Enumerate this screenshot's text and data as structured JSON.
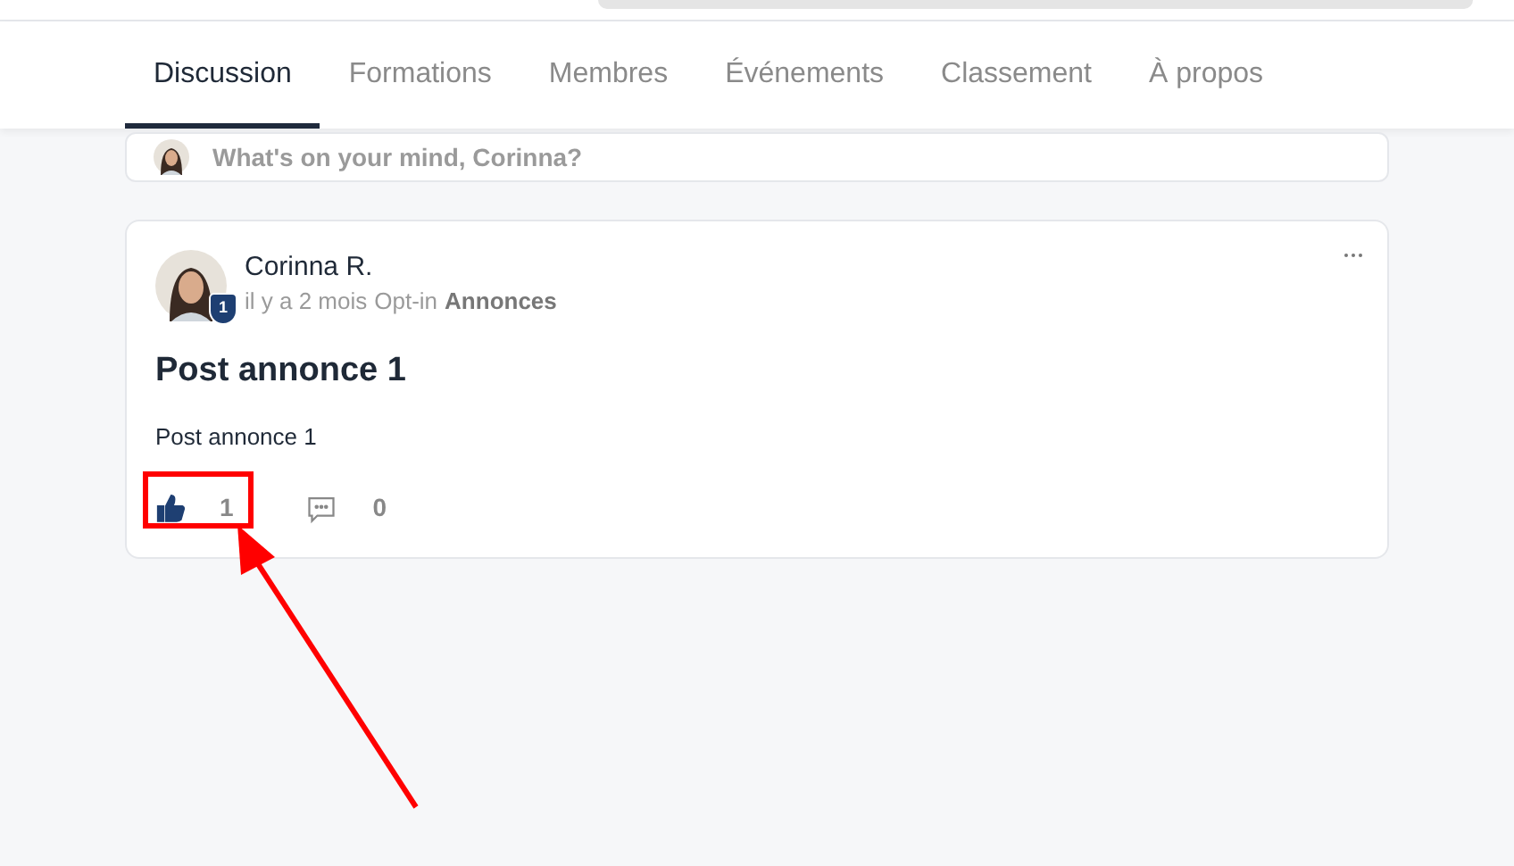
{
  "tabs": [
    {
      "label": "Discussion",
      "selected": true
    },
    {
      "label": "Formations",
      "selected": false
    },
    {
      "label": "Membres",
      "selected": false
    },
    {
      "label": "Événements",
      "selected": false
    },
    {
      "label": "Classement",
      "selected": false
    },
    {
      "label": "À propos",
      "selected": false
    }
  ],
  "composer": {
    "placeholder": "What's on your mind, Corinna?"
  },
  "post": {
    "author": "Corinna R.",
    "badge": "1",
    "time": "il y a 2 mois",
    "audience": "Opt-in",
    "space": "Annonces",
    "title": "Post annonce 1",
    "body": "Post annonce 1",
    "likes": "1",
    "liked": true,
    "comments": "0"
  },
  "annotation": {
    "highlight": true
  }
}
